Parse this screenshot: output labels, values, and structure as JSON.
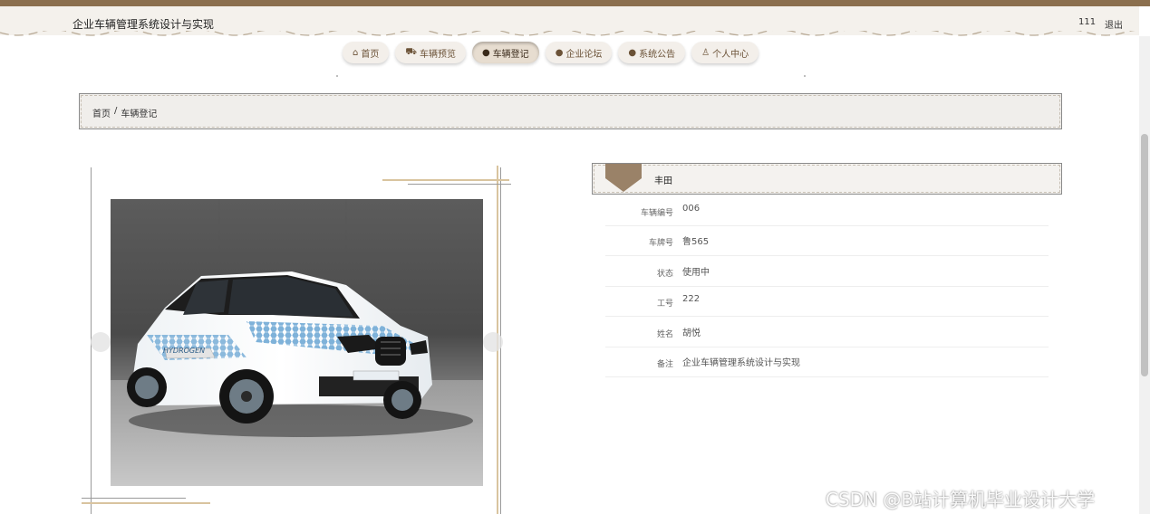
{
  "header": {
    "site_title": "企业车辆管理系统设计与实现",
    "user_name": "111",
    "logout_label": "退出"
  },
  "nav": {
    "items": [
      {
        "label": "首页",
        "icon": "home-icon"
      },
      {
        "label": "车辆预览",
        "icon": "car-icon"
      },
      {
        "label": "车辆登记",
        "icon": "info-icon"
      },
      {
        "label": "企业论坛",
        "icon": "forum-icon"
      },
      {
        "label": "系统公告",
        "icon": "notice-icon"
      },
      {
        "label": "个人中心",
        "icon": "user-icon"
      }
    ],
    "active_index": 2
  },
  "breadcrumb": {
    "home": "首页",
    "separator": "/",
    "current": "车辆登记"
  },
  "details": {
    "title": "丰田",
    "rows": [
      {
        "label": "车辆编号",
        "value": "006"
      },
      {
        "label": "车牌号",
        "value": "鲁565"
      },
      {
        "label": "状态",
        "value": "使用中"
      },
      {
        "label": "工号",
        "value": "222"
      },
      {
        "label": "姓名",
        "value": "胡悦"
      },
      {
        "label": "备注",
        "value": "企业车辆管理系统设计与实现"
      }
    ]
  },
  "photo": {
    "plate_text": "HYDROGEN",
    "alt": "white SUV with blue livery"
  },
  "watermark": "CSDN @B站计算机毕业设计大学",
  "colors": {
    "brand_brown": "#8b6f4e",
    "header_bg": "#f4f1ec",
    "nav_text": "#6b5237"
  }
}
